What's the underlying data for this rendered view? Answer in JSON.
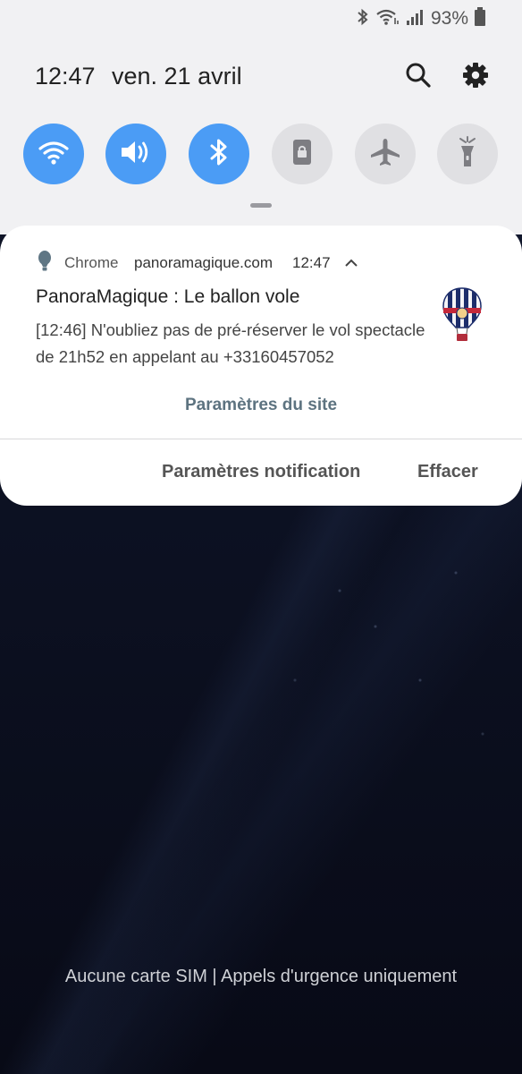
{
  "status_bar": {
    "battery_percent": "93%",
    "icons": [
      "bluetooth-icon",
      "wifi-icon",
      "signal-icon",
      "battery-icon"
    ]
  },
  "header": {
    "time": "12:47",
    "date": "ven. 21 avril",
    "icons": [
      "search-icon",
      "settings-gear-icon"
    ]
  },
  "quick_tiles": [
    {
      "name": "wifi",
      "state": "on"
    },
    {
      "name": "sound",
      "state": "on"
    },
    {
      "name": "bluetooth",
      "state": "on"
    },
    {
      "name": "portrait-lock",
      "state": "off"
    },
    {
      "name": "airplane-mode",
      "state": "off"
    },
    {
      "name": "flashlight",
      "state": "off"
    }
  ],
  "notification": {
    "app_name": "Chrome",
    "site": "panoramagique.com",
    "time": "12:47",
    "title": "PanoraMagique : Le ballon vole",
    "body": "[12:46] N'oubliez pas de pré-réserver le vol spectacle de 21h52 en appelant au +33160457052",
    "site_settings_label": "Paramètres du site",
    "actions": {
      "notification_settings": "Paramètres notification",
      "clear": "Effacer"
    }
  },
  "lockscreen": {
    "sim_status": "Aucune carte SIM | Appels d'urgence uniquement"
  },
  "colors": {
    "tile_on": "#4b9cf5",
    "tile_off": "#e0e0e3",
    "site_settings": "#5d7380"
  }
}
